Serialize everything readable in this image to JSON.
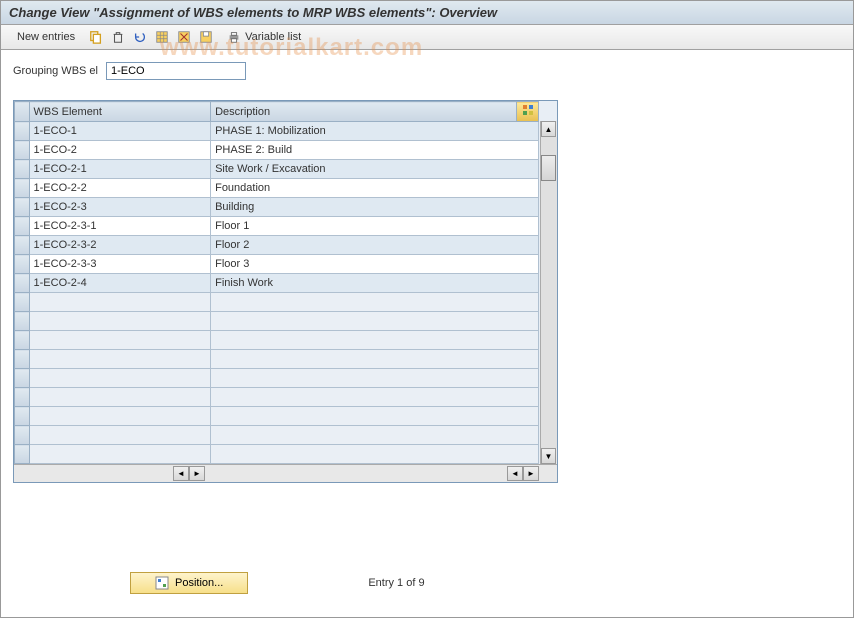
{
  "title": "Change View \"Assignment of WBS elements to MRP WBS elements\": Overview",
  "toolbar": {
    "new_entries": "New entries",
    "variable_list": "Variable list"
  },
  "filter": {
    "label": "Grouping WBS el",
    "value": "1-ECO"
  },
  "table": {
    "columns": {
      "wbs": "WBS Element",
      "desc": "Description"
    },
    "rows": [
      {
        "wbs": "1-ECO-1",
        "desc": "PHASE 1: Mobilization"
      },
      {
        "wbs": "1-ECO-2",
        "desc": "PHASE 2: Build"
      },
      {
        "wbs": "1-ECO-2-1",
        "desc": "Site Work / Excavation"
      },
      {
        "wbs": "1-ECO-2-2",
        "desc": "Foundation"
      },
      {
        "wbs": "1-ECO-2-3",
        "desc": "Building"
      },
      {
        "wbs": "1-ECO-2-3-1",
        "desc": "Floor 1"
      },
      {
        "wbs": "1-ECO-2-3-2",
        "desc": "Floor 2"
      },
      {
        "wbs": "1-ECO-2-3-3",
        "desc": "Floor 3"
      },
      {
        "wbs": "1-ECO-2-4",
        "desc": "Finish Work"
      }
    ],
    "empty_rows": 9
  },
  "footer": {
    "position_btn": "Position...",
    "entry_text": "Entry 1 of 9"
  },
  "watermark": "www.tutorialkart.com"
}
